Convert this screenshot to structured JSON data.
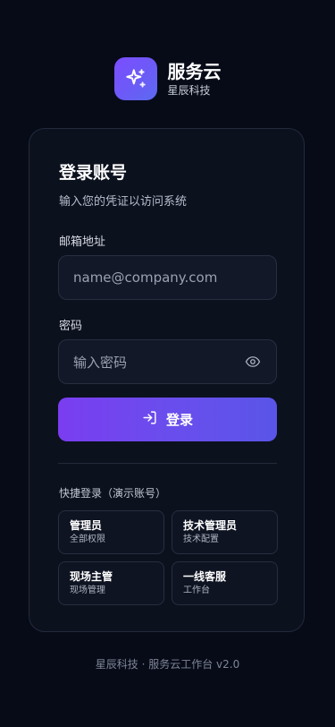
{
  "brand": {
    "name": "服务云",
    "subtitle": "星辰科技",
    "logo_icon": "sparkles-icon"
  },
  "login": {
    "title": "登录账号",
    "subtitle": "输入您的凭证以访问系统",
    "email_label": "邮箱地址",
    "email_placeholder": "name@company.com",
    "email_value": "",
    "password_label": "密码",
    "password_placeholder": "输入密码",
    "password_value": "",
    "password_toggle_icon": "eye-icon",
    "submit_label": "登录",
    "submit_icon": "login-arrow-icon"
  },
  "quick_login": {
    "title": "快捷登录（演示账号）",
    "items": [
      {
        "name": "管理员",
        "desc": "全部权限"
      },
      {
        "name": "技术管理员",
        "desc": "技术配置"
      },
      {
        "name": "现场主管",
        "desc": "现场管理"
      },
      {
        "name": "一线客服",
        "desc": "工作台"
      }
    ]
  },
  "footer": {
    "text": "星辰科技 · 服务云工作台 v2.0"
  },
  "colors": {
    "background": "#070b18",
    "card": "#0c111e",
    "accent_start": "#7a3df0",
    "accent_end": "#5a55e8"
  }
}
